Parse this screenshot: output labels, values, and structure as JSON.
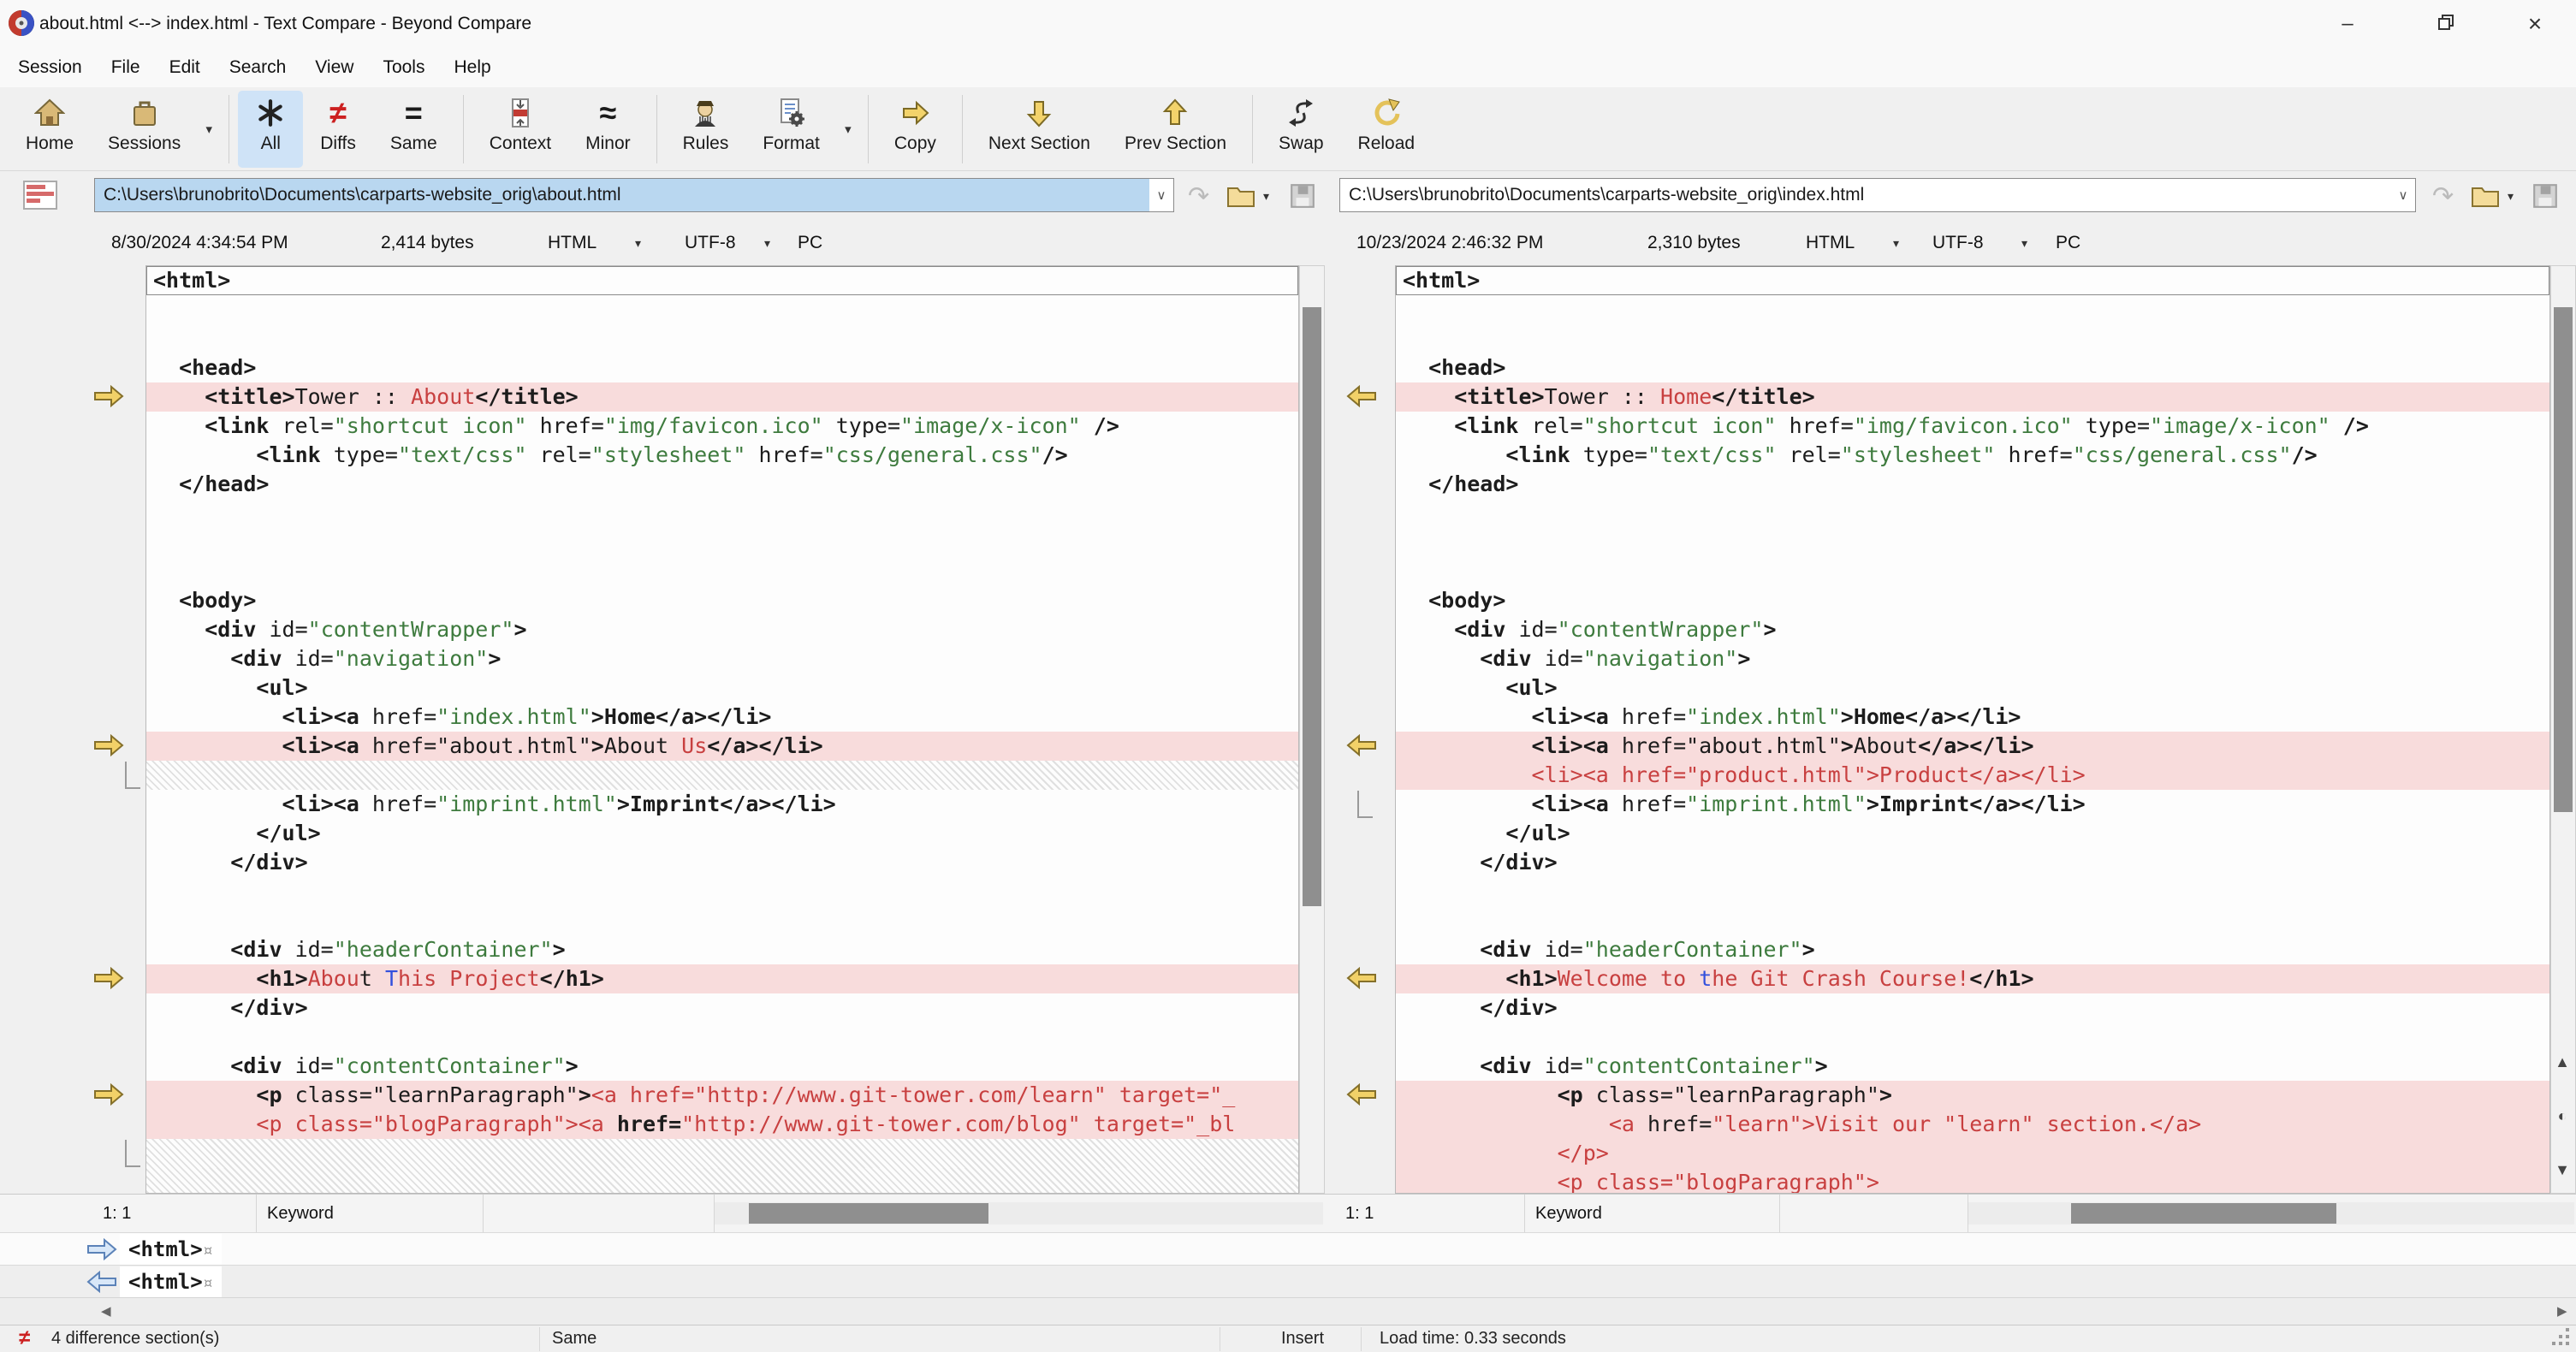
{
  "window": {
    "title": "about.html <--> index.html - Text Compare - Beyond Compare"
  },
  "icons": {
    "dropdown": "▾",
    "combo_chevron": "∨",
    "swoosh": "↷",
    "scroll_left": "◀",
    "scroll_right": "▶",
    "scroll_up_mark": "▲",
    "scroll_pos_mark": "◐",
    "scroll_down_mark": "▼",
    "minimize": "–",
    "close": "×",
    "eol_mark": "¤",
    "neq": "≠"
  },
  "menu": [
    "Session",
    "File",
    "Edit",
    "Search",
    "View",
    "Tools",
    "Help"
  ],
  "toolbar": [
    {
      "id": "home",
      "label": "Home"
    },
    {
      "id": "sessions",
      "label": "Sessions",
      "dd": true
    },
    {
      "sep": true
    },
    {
      "id": "all",
      "label": "All",
      "active": true
    },
    {
      "id": "diffs",
      "label": "Diffs"
    },
    {
      "id": "same",
      "label": "Same"
    },
    {
      "sep": true
    },
    {
      "id": "context",
      "label": "Context"
    },
    {
      "id": "minor",
      "label": "Minor"
    },
    {
      "sep": true
    },
    {
      "id": "rules",
      "label": "Rules"
    },
    {
      "id": "format",
      "label": "Format",
      "dd": true
    },
    {
      "sep": true
    },
    {
      "id": "copy",
      "label": "Copy"
    },
    {
      "sep": true
    },
    {
      "id": "next-section",
      "label": "Next Section"
    },
    {
      "id": "prev-section",
      "label": "Prev Section"
    },
    {
      "sep": true
    },
    {
      "id": "swap",
      "label": "Swap"
    },
    {
      "id": "reload",
      "label": "Reload"
    }
  ],
  "left": {
    "path": "C:\\Users\\brunobrito\\Documents\\carparts-website_orig\\about.html",
    "modified": "8/30/2024 4:34:54 PM",
    "size": "2,414 bytes",
    "format": "HTML",
    "encoding": "UTF-8",
    "line_endings": "PC",
    "position": "1: 1",
    "grammar": "Keyword",
    "lines": [
      {
        "cur": true,
        "tok": [
          [
            "t",
            "<html>"
          ]
        ]
      },
      {
        "tok": []
      },
      {
        "tok": []
      },
      {
        "tok": [
          [
            "t",
            "  <head>"
          ]
        ]
      },
      {
        "bg": "d",
        "arrow": true,
        "tok": [
          [
            "t",
            "    <title>"
          ],
          [
            "k",
            "Tower :: "
          ],
          [
            "r",
            "About"
          ],
          [
            "t",
            "</title>"
          ]
        ]
      },
      {
        "tok": [
          [
            "t",
            "    <link"
          ],
          [
            "k",
            " rel="
          ],
          [
            "s",
            "\"shortcut icon\""
          ],
          [
            "k",
            " href="
          ],
          [
            "s",
            "\"img/favicon.ico\""
          ],
          [
            "k",
            " type="
          ],
          [
            "s",
            "\"image/x-icon\""
          ],
          [
            "t",
            " />"
          ]
        ]
      },
      {
        "tok": [
          [
            "t",
            "        <link"
          ],
          [
            "k",
            " type="
          ],
          [
            "s",
            "\"text/css\""
          ],
          [
            "k",
            " rel="
          ],
          [
            "s",
            "\"stylesheet\""
          ],
          [
            "k",
            " href="
          ],
          [
            "s",
            "\"css/general.css\""
          ],
          [
            "t",
            "/>"
          ]
        ]
      },
      {
        "tok": [
          [
            "t",
            "  </head>"
          ]
        ]
      },
      {
        "tok": []
      },
      {
        "tok": []
      },
      {
        "tok": []
      },
      {
        "tok": [
          [
            "t",
            "  <body>"
          ]
        ]
      },
      {
        "tok": [
          [
            "t",
            "    <div"
          ],
          [
            "k",
            " id="
          ],
          [
            "s",
            "\"contentWrapper\""
          ],
          [
            "t",
            ">"
          ]
        ]
      },
      {
        "tok": [
          [
            "t",
            "      <div"
          ],
          [
            "k",
            " id="
          ],
          [
            "s",
            "\"navigation\""
          ],
          [
            "t",
            ">"
          ]
        ]
      },
      {
        "tok": [
          [
            "t",
            "        <ul>"
          ]
        ]
      },
      {
        "tok": [
          [
            "t",
            "          <li><a"
          ],
          [
            "k",
            " href="
          ],
          [
            "s",
            "\"index.html\""
          ],
          [
            "t",
            ">Home</a></li>"
          ]
        ]
      },
      {
        "bg": "d",
        "arrow": true,
        "tok": [
          [
            "t",
            "          <li><a"
          ],
          [
            "k",
            " href=\"about.html\""
          ],
          [
            "t",
            ">"
          ],
          [
            "k",
            "About "
          ],
          [
            "r",
            "Us"
          ],
          [
            "t",
            "</a></li>"
          ]
        ]
      },
      {
        "bg": "g",
        "bracket": true
      },
      {
        "tok": [
          [
            "t",
            "          <li><a"
          ],
          [
            "k",
            " href="
          ],
          [
            "s",
            "\"imprint.html\""
          ],
          [
            "t",
            ">Imprint</a></li>"
          ]
        ]
      },
      {
        "tok": [
          [
            "t",
            "        </ul>"
          ]
        ]
      },
      {
        "tok": [
          [
            "t",
            "      </div>"
          ]
        ]
      },
      {
        "tok": []
      },
      {
        "tok": []
      },
      {
        "tok": [
          [
            "t",
            "      <div"
          ],
          [
            "k",
            " id="
          ],
          [
            "s",
            "\"headerContainer\""
          ],
          [
            "t",
            ">"
          ]
        ]
      },
      {
        "bg": "d",
        "arrow": true,
        "tok": [
          [
            "t",
            "        <h1>"
          ],
          [
            "r",
            "Abou"
          ],
          [
            "k",
            "t "
          ],
          [
            "b",
            "T"
          ],
          [
            "r",
            "his Project"
          ],
          [
            "t",
            "</h1>"
          ]
        ]
      },
      {
        "tok": [
          [
            "t",
            "      </div>"
          ]
        ]
      },
      {
        "tok": []
      },
      {
        "tok": [
          [
            "t",
            "      <div"
          ],
          [
            "k",
            " id="
          ],
          [
            "s",
            "\"contentContainer\""
          ],
          [
            "t",
            ">"
          ]
        ]
      },
      {
        "bg": "d",
        "arrow": true,
        "tok": [
          [
            "t",
            "        <p"
          ],
          [
            "k",
            " class=\"learnParagraph\""
          ],
          [
            "t",
            ">"
          ],
          [
            "r",
            "<a href=\"http://www.git-tower.com/learn\" target=\"_"
          ]
        ]
      },
      {
        "bg": "d",
        "tok": [
          [
            "r",
            "        <p class=\"blogParagraph\"><a "
          ],
          [
            "t",
            "href="
          ],
          [
            "r",
            "\"http://www.git-tower.com/blog\" target=\"_bl"
          ]
        ]
      },
      {
        "bg": "g",
        "bracket": true
      },
      {
        "bg": "g"
      }
    ]
  },
  "right": {
    "path": "C:\\Users\\brunobrito\\Documents\\carparts-website_orig\\index.html",
    "modified": "10/23/2024 2:46:32 PM",
    "size": "2,310 bytes",
    "format": "HTML",
    "encoding": "UTF-8",
    "line_endings": "PC",
    "position": "1: 1",
    "grammar": "Keyword",
    "lines": [
      {
        "cur": true,
        "tok": [
          [
            "t",
            "<html>"
          ]
        ]
      },
      {
        "tok": []
      },
      {
        "tok": []
      },
      {
        "tok": [
          [
            "t",
            "  <head>"
          ]
        ]
      },
      {
        "bg": "d",
        "arrow": true,
        "tok": [
          [
            "t",
            "    <title>"
          ],
          [
            "k",
            "Tower :: "
          ],
          [
            "r",
            "Home"
          ],
          [
            "t",
            "</title>"
          ]
        ]
      },
      {
        "tok": [
          [
            "t",
            "    <link"
          ],
          [
            "k",
            " rel="
          ],
          [
            "s",
            "\"shortcut icon\""
          ],
          [
            "k",
            " href="
          ],
          [
            "s",
            "\"img/favicon.ico\""
          ],
          [
            "k",
            " type="
          ],
          [
            "s",
            "\"image/x-icon\""
          ],
          [
            "t",
            " />"
          ]
        ]
      },
      {
        "tok": [
          [
            "t",
            "        <link"
          ],
          [
            "k",
            " type="
          ],
          [
            "s",
            "\"text/css\""
          ],
          [
            "k",
            " rel="
          ],
          [
            "s",
            "\"stylesheet\""
          ],
          [
            "k",
            " href="
          ],
          [
            "s",
            "\"css/general.css\""
          ],
          [
            "t",
            "/>"
          ]
        ]
      },
      {
        "tok": [
          [
            "t",
            "  </head>"
          ]
        ]
      },
      {
        "tok": []
      },
      {
        "tok": []
      },
      {
        "tok": []
      },
      {
        "tok": [
          [
            "t",
            "  <body>"
          ]
        ]
      },
      {
        "tok": [
          [
            "t",
            "    <div"
          ],
          [
            "k",
            " id="
          ],
          [
            "s",
            "\"contentWrapper\""
          ],
          [
            "t",
            ">"
          ]
        ]
      },
      {
        "tok": [
          [
            "t",
            "      <div"
          ],
          [
            "k",
            " id="
          ],
          [
            "s",
            "\"navigation\""
          ],
          [
            "t",
            ">"
          ]
        ]
      },
      {
        "tok": [
          [
            "t",
            "        <ul>"
          ]
        ]
      },
      {
        "tok": [
          [
            "t",
            "          <li><a"
          ],
          [
            "k",
            " href="
          ],
          [
            "s",
            "\"index.html\""
          ],
          [
            "t",
            ">Home</a></li>"
          ]
        ]
      },
      {
        "bg": "d",
        "arrow": true,
        "tok": [
          [
            "t",
            "          <li><a"
          ],
          [
            "k",
            " href=\"about.html\""
          ],
          [
            "t",
            ">"
          ],
          [
            "k",
            "About"
          ],
          [
            "t",
            "</a></li>"
          ]
        ]
      },
      {
        "bg": "d",
        "tok": [
          [
            "r",
            "          <li><a href=\"product.html\">Product</a></li>"
          ]
        ]
      },
      {
        "bracket": true,
        "tok": [
          [
            "t",
            "          <li><a"
          ],
          [
            "k",
            " href="
          ],
          [
            "s",
            "\"imprint.html\""
          ],
          [
            "t",
            ">Imprint</a></li>"
          ]
        ]
      },
      {
        "tok": [
          [
            "t",
            "        </ul>"
          ]
        ]
      },
      {
        "tok": [
          [
            "t",
            "      </div>"
          ]
        ]
      },
      {
        "tok": []
      },
      {
        "tok": []
      },
      {
        "tok": [
          [
            "t",
            "      <div"
          ],
          [
            "k",
            " id="
          ],
          [
            "s",
            "\"headerContainer\""
          ],
          [
            "t",
            ">"
          ]
        ]
      },
      {
        "bg": "d",
        "arrow": true,
        "tok": [
          [
            "t",
            "        <h1>"
          ],
          [
            "r",
            "Welcome to "
          ],
          [
            "b",
            "t"
          ],
          [
            "r",
            "he Git Crash Course!"
          ],
          [
            "t",
            "</h1>"
          ]
        ]
      },
      {
        "tok": [
          [
            "t",
            "      </div>"
          ]
        ]
      },
      {
        "tok": []
      },
      {
        "tok": [
          [
            "t",
            "      <div"
          ],
          [
            "k",
            " id="
          ],
          [
            "s",
            "\"contentContainer\""
          ],
          [
            "t",
            ">"
          ]
        ]
      },
      {
        "bg": "d",
        "arrow": true,
        "tok": [
          [
            "t",
            "            <p"
          ],
          [
            "k",
            " class=\"learnParagraph\""
          ],
          [
            "t",
            ">"
          ]
        ]
      },
      {
        "bg": "d",
        "tok": [
          [
            "r",
            "                <a "
          ],
          [
            "k",
            "href="
          ],
          [
            "r",
            "\"learn\">Visit our \"learn\" section.</a>"
          ]
        ]
      },
      {
        "bg": "d",
        "tok": [
          [
            "r",
            "            </p>"
          ]
        ]
      },
      {
        "bg": "d",
        "tok": [
          [
            "r",
            "            <p class=\"blogParagraph\">"
          ]
        ]
      }
    ]
  },
  "inspector": [
    {
      "dir": "r",
      "tok": [
        [
          "t",
          "<html>"
        ],
        [
          "e",
          "¤"
        ]
      ]
    },
    {
      "dir": "l",
      "tok": [
        [
          "t",
          "<html>"
        ],
        [
          "e",
          "¤"
        ]
      ]
    }
  ],
  "statusbar": {
    "sections": "4 difference section(s)",
    "mode": "Same",
    "edit": "Insert",
    "load": "Load time: 0.33 seconds"
  }
}
